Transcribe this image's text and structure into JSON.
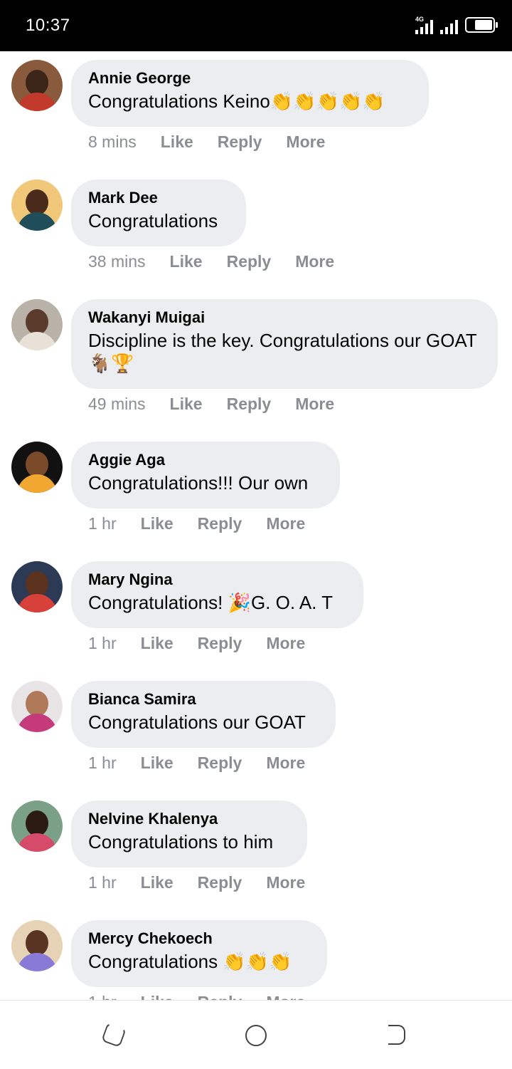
{
  "status_bar": {
    "time": "10:37",
    "network": "4G"
  },
  "actions": {
    "like": "Like",
    "reply": "Reply",
    "more": "More"
  },
  "comments": [
    {
      "author": "Annie George",
      "text": "Congratulations Keino",
      "emoji": "👏👏👏👏👏",
      "time": "8 mins"
    },
    {
      "author": "Mark Dee",
      "text": "Congratulations",
      "emoji": "",
      "time": "38 mins"
    },
    {
      "author": "Wakanyi Muigai",
      "text": "Discipline is the key. Congratulations our GOAT ",
      "emoji": "🐐🏆",
      "time": "49 mins"
    },
    {
      "author": "Aggie Aga",
      "text": "Congratulations!!! Our own",
      "emoji": "",
      "time": "1 hr"
    },
    {
      "author": "Mary Ngina",
      "text": "Congratulations! ",
      "emoji": "🎉",
      "text_after": "G. O. A. T",
      "time": "1 hr"
    },
    {
      "author": "Bianca Samira",
      "text": "Congratulations our GOAT",
      "emoji": "",
      "time": "1 hr"
    },
    {
      "author": "Nelvine Khalenya",
      "text": "Congratulations to him",
      "emoji": "",
      "time": "1 hr"
    },
    {
      "author": "Mercy Chekoech",
      "text": "Congratulations ",
      "emoji": "👏👏👏",
      "time": "1 hr"
    }
  ],
  "colors": {
    "bubble": "#ebedf0",
    "meta": "#8a8d91",
    "text": "#050505"
  },
  "icons": {
    "nav_recent": "recent-apps-icon",
    "nav_home": "home-icon",
    "nav_back": "back-icon"
  }
}
